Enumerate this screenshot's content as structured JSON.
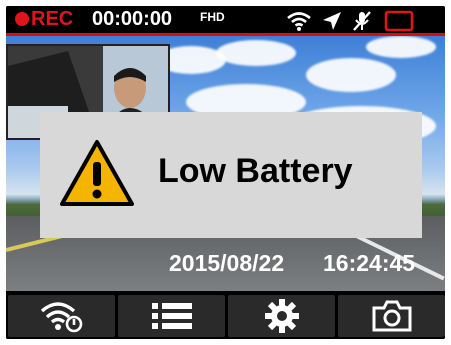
{
  "status_bar": {
    "record_label": "REC",
    "record_time": "00:00:00",
    "resolution": "FHD",
    "colors": {
      "record": "#e0151c",
      "accent_line": "#d40f0f"
    },
    "icons": [
      "wifi-icon",
      "gps-arrow-icon",
      "mic-muted-icon",
      "memory-card-icon"
    ]
  },
  "alert": {
    "icon": "warning-icon",
    "message": "Low Battery"
  },
  "overlay": {
    "date": "2015/08/22",
    "time": "16:24:45"
  },
  "toolbar": {
    "buttons": [
      {
        "icon": "wifi-settings-icon"
      },
      {
        "icon": "menu-list-icon"
      },
      {
        "icon": "gear-icon"
      },
      {
        "icon": "camera-icon"
      }
    ]
  }
}
